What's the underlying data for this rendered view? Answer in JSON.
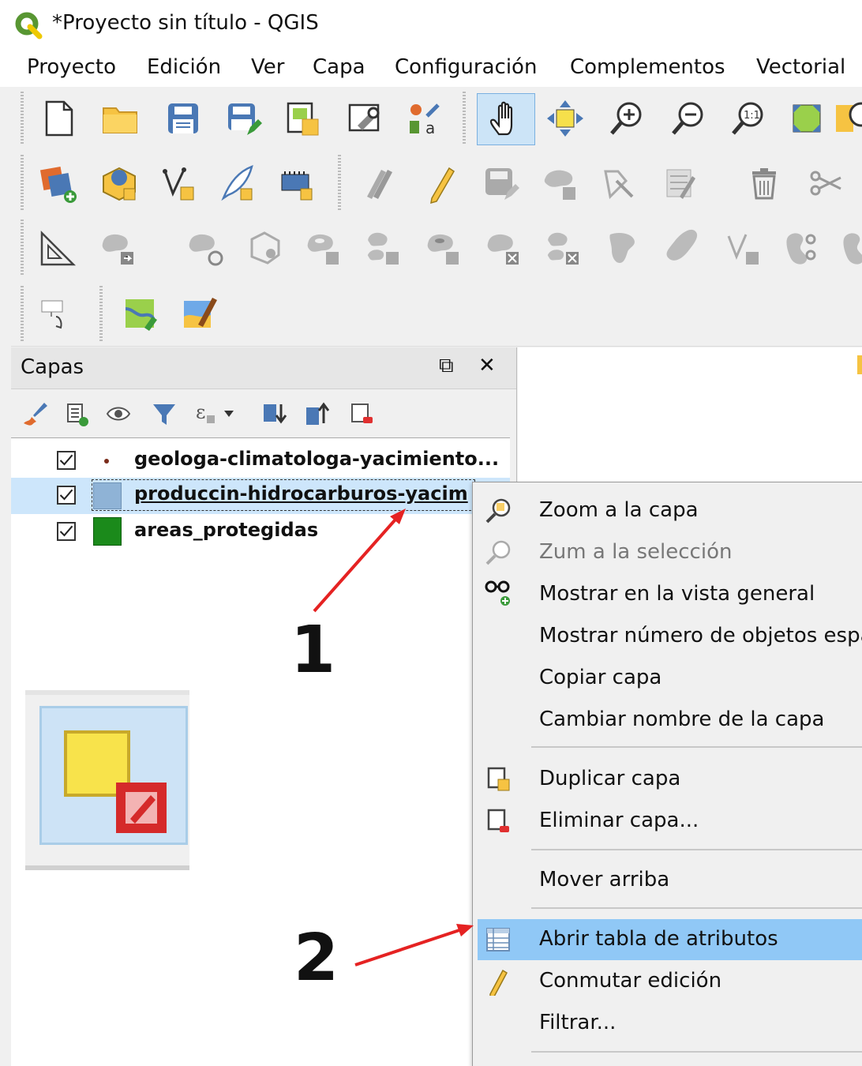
{
  "window": {
    "title": "*Proyecto sin título - QGIS"
  },
  "menubar": [
    "Proyecto",
    "Edición",
    "Ver",
    "Capa",
    "Configuración",
    "Complementos",
    "Vectorial"
  ],
  "layers_panel": {
    "title": "Capas",
    "float_icon": "⧉",
    "close_icon": "✕",
    "layers": [
      {
        "name": "geologa-climatologa-yacimiento...",
        "checked": true,
        "symbol": "point",
        "color": "#7a2b1a"
      },
      {
        "name": "produccin-hidrocarburos-yacim",
        "checked": true,
        "symbol": "fill",
        "color": "#8fb3d6",
        "selected": true
      },
      {
        "name": "areas_protegidas",
        "checked": true,
        "symbol": "fill",
        "color": "#1b8a1b"
      }
    ]
  },
  "context_menu": {
    "items": [
      {
        "label": "Zoom a la capa",
        "icon": "zoom-layer-icon",
        "enabled": true
      },
      {
        "label": "Zum a la selección",
        "icon": "zoom-selection-icon",
        "enabled": false
      },
      {
        "label": "Mostrar en la vista general",
        "icon": "overview-icon",
        "enabled": true
      },
      {
        "label": "Mostrar número de objetos espa",
        "icon": "",
        "enabled": true
      },
      {
        "label": "Copiar capa",
        "icon": "",
        "enabled": true
      },
      {
        "label": "Cambiar nombre de la capa",
        "icon": "",
        "enabled": true
      },
      {
        "label": "Duplicar capa",
        "icon": "duplicate-layer-icon",
        "enabled": true
      },
      {
        "label": "Eliminar capa...",
        "icon": "remove-layer-icon",
        "enabled": true
      },
      {
        "label": "Mover arriba",
        "icon": "",
        "enabled": true
      },
      {
        "label": "Abrir tabla de atributos",
        "icon": "attribute-table-icon",
        "enabled": true,
        "highlighted": true
      },
      {
        "label": "Conmutar edición",
        "icon": "pencil-icon",
        "enabled": true
      },
      {
        "label": "Filtrar...",
        "icon": "",
        "enabled": true
      }
    ]
  },
  "annotations": {
    "step1": "1",
    "step2": "2",
    "arrow_color": "#e52222"
  },
  "colors": {
    "highlight": "#90c8f6",
    "selected_row": "#cde6fb"
  }
}
